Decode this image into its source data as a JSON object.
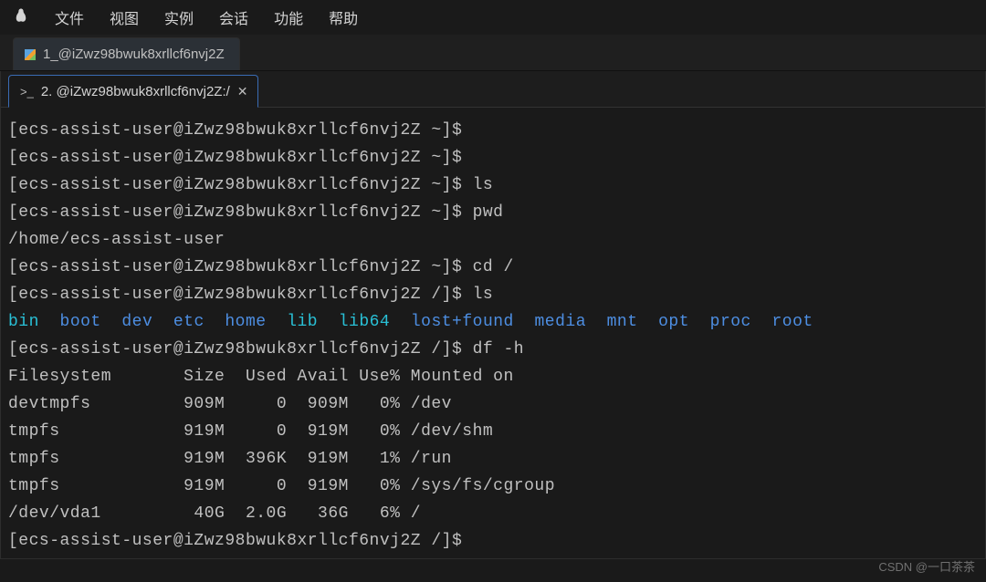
{
  "menu": {
    "items": [
      "文件",
      "视图",
      "实例",
      "会话",
      "功能",
      "帮助"
    ]
  },
  "tabs": {
    "main": {
      "label": "1_@iZwz98bwuk8xrllcf6nvj2Z"
    },
    "sub": {
      "label": "2. @iZwz98bwuk8xrllcf6nvj2Z:/"
    }
  },
  "prompt": {
    "user": "ecs-assist-user",
    "host": "iZwz98bwuk8xrllcf6nvj2Z",
    "home_cwd": "~",
    "root_cwd": "/",
    "sym": "$"
  },
  "session": {
    "cmd_empty": "",
    "cmd_ls": "ls",
    "cmd_pwd": "pwd",
    "pwd_out": "/home/ecs-assist-user",
    "cmd_cdroot": "cd /",
    "cmd_ls2": "ls",
    "cmd_df": "df -h"
  },
  "ls_root": [
    {
      "name": "bin",
      "cls": "cyan"
    },
    {
      "name": "boot",
      "cls": "blue"
    },
    {
      "name": "dev",
      "cls": "blue"
    },
    {
      "name": "etc",
      "cls": "blue"
    },
    {
      "name": "home",
      "cls": "blue"
    },
    {
      "name": "lib",
      "cls": "cyan"
    },
    {
      "name": "lib64",
      "cls": "cyan"
    },
    {
      "name": "lost+found",
      "cls": "blue"
    },
    {
      "name": "media",
      "cls": "blue"
    },
    {
      "name": "mnt",
      "cls": "blue"
    },
    {
      "name": "opt",
      "cls": "blue"
    },
    {
      "name": "proc",
      "cls": "blue"
    },
    {
      "name": "root",
      "cls": "blue"
    }
  ],
  "df": {
    "header": [
      "Filesystem",
      "Size",
      "Used",
      "Avail",
      "Use%",
      "Mounted on"
    ],
    "rows": [
      {
        "fs": "devtmpfs",
        "size": "909M",
        "used": "0",
        "avail": "909M",
        "usep": "0%",
        "mnt": "/dev"
      },
      {
        "fs": "tmpfs",
        "size": "919M",
        "used": "0",
        "avail": "919M",
        "usep": "0%",
        "mnt": "/dev/shm"
      },
      {
        "fs": "tmpfs",
        "size": "919M",
        "used": "396K",
        "avail": "919M",
        "usep": "1%",
        "mnt": "/run"
      },
      {
        "fs": "tmpfs",
        "size": "919M",
        "used": "0",
        "avail": "919M",
        "usep": "0%",
        "mnt": "/sys/fs/cgroup"
      },
      {
        "fs": "/dev/vda1",
        "size": "40G",
        "used": "2.0G",
        "avail": "36G",
        "usep": "6%",
        "mnt": "/"
      }
    ]
  },
  "watermark": "CSDN @一口茶茶"
}
